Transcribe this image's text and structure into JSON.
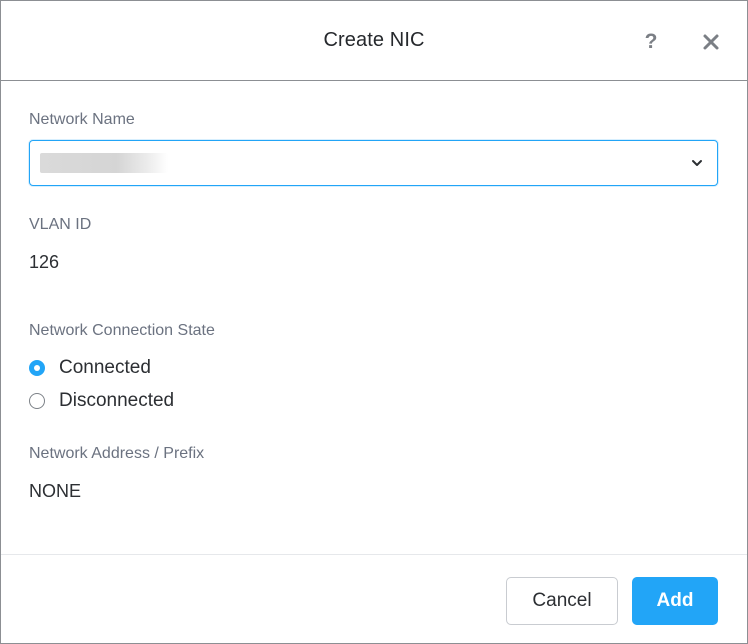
{
  "dialog": {
    "title": "Create NIC",
    "help_symbol": "?",
    "icons": {
      "help": "help-icon",
      "close": "close-icon",
      "dropdown": "chevron-down-icon"
    }
  },
  "form": {
    "network_name": {
      "label": "Network Name",
      "selected_value": ""
    },
    "vlan_id": {
      "label": "VLAN ID",
      "value": "126"
    },
    "connection_state": {
      "label": "Network Connection State",
      "options": [
        {
          "label": "Connected",
          "checked": true
        },
        {
          "label": "Disconnected",
          "checked": false
        }
      ]
    },
    "network_address": {
      "label": "Network Address / Prefix",
      "value": "NONE"
    }
  },
  "footer": {
    "cancel_label": "Cancel",
    "add_label": "Add"
  },
  "colors": {
    "accent": "#22a5f7",
    "border": "#8c8f93",
    "label": "#6b7280"
  }
}
